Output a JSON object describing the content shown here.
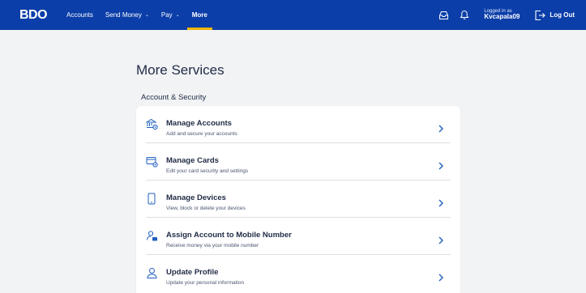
{
  "brand": {
    "logo_text": "BDO",
    "accent": "#f2b705",
    "primary": "#0b3ea8"
  },
  "nav": {
    "items": [
      {
        "label": "Accounts",
        "dropdown": false
      },
      {
        "label": "Send Money",
        "dropdown": true
      },
      {
        "label": "Pay",
        "dropdown": true
      },
      {
        "label": "More",
        "dropdown": false,
        "active": true
      }
    ]
  },
  "header": {
    "logged_in_label": "Logged in as",
    "username": "Kvcapala09",
    "logout_label": "Log Out"
  },
  "page": {
    "title": "More Services",
    "section_title": "Account & Security"
  },
  "services": [
    {
      "title": "Manage Accounts",
      "subtitle": "Add and secure your accounts",
      "icon": "bank-gear-icon"
    },
    {
      "title": "Manage Cards",
      "subtitle": "Edit your card security and settings",
      "icon": "card-gear-icon"
    },
    {
      "title": "Manage Devices",
      "subtitle": "View, block or delete your devices",
      "icon": "phone-icon"
    },
    {
      "title": "Assign Account to Mobile Number",
      "subtitle": "Receive money via your mobile number",
      "icon": "user-card-icon"
    },
    {
      "title": "Update Profile",
      "subtitle": "Update your personal information",
      "icon": "user-icon"
    }
  ]
}
